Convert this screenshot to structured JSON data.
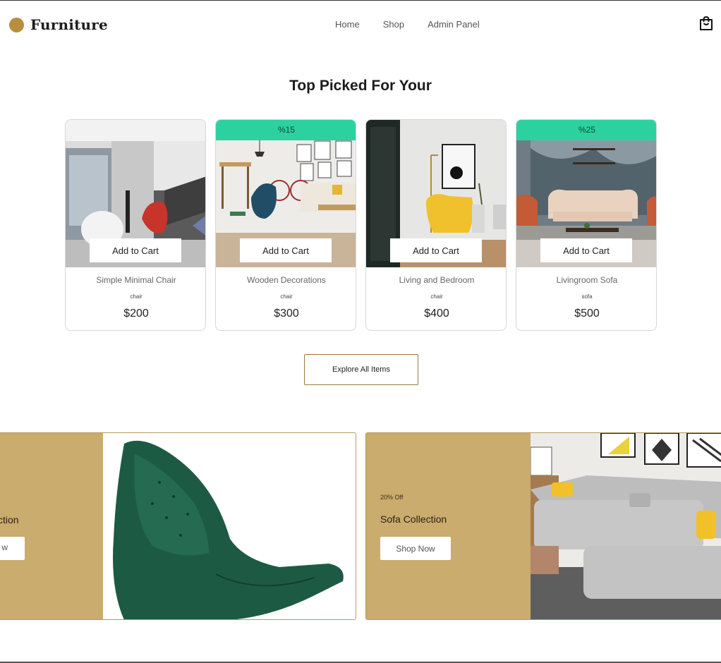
{
  "brand": {
    "name": "Furniture"
  },
  "nav": {
    "items": [
      "Home",
      "Shop",
      "Admin Panel"
    ]
  },
  "section": {
    "title": "Top Picked For Your"
  },
  "products": [
    {
      "name": "Simple Minimal Chair",
      "category": "chair",
      "price": "$200",
      "discount": "",
      "add_label": "Add to Cart"
    },
    {
      "name": "Wooden Decorations",
      "category": "chair",
      "price": "$300",
      "discount": "%15",
      "add_label": "Add to Cart"
    },
    {
      "name": "Living and Bedroom",
      "category": "chair",
      "price": "$400",
      "discount": "",
      "add_label": "Add to Cart"
    },
    {
      "name": "Livingroom Sofa",
      "category": "sofa",
      "price": "$500",
      "discount": "%25",
      "add_label": "Add to Cart"
    }
  ],
  "explore": {
    "label": "Explore All Items"
  },
  "banners": [
    {
      "title_fragment": "ction",
      "button_fragment": "w"
    },
    {
      "small": "20% Off",
      "title": "Sofa Collection",
      "button": "Shop Now"
    }
  ],
  "icons": {
    "cart": "shopping-bag-icon"
  },
  "colors": {
    "accent": "#b88e3e",
    "discount": "#2bd29f",
    "banner": "#c9ac6e"
  }
}
